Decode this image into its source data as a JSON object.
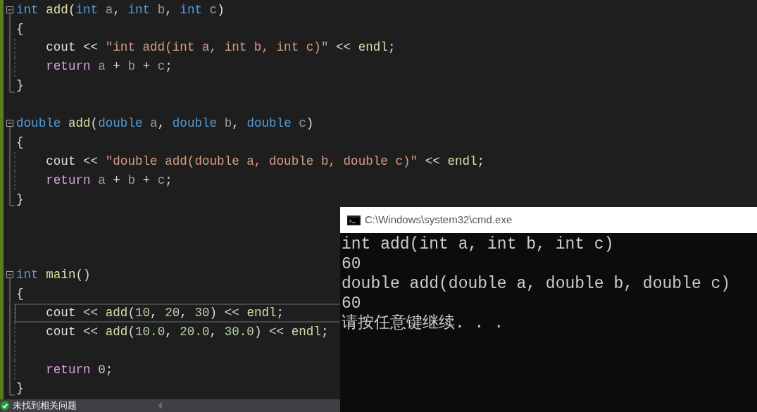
{
  "editor": {
    "lines": [
      {
        "kind": "code",
        "current": false,
        "tokens": [
          {
            "text": "int",
            "kind": "keyword"
          },
          {
            "text": " add",
            "kind": "function"
          },
          {
            "text": "(",
            "kind": "plain"
          },
          {
            "text": "int",
            "kind": "keyword"
          },
          {
            "text": " a",
            "kind": "param"
          },
          {
            "text": ", ",
            "kind": "plain"
          },
          {
            "text": "int",
            "kind": "keyword"
          },
          {
            "text": " b",
            "kind": "param"
          },
          {
            "text": ", ",
            "kind": "plain"
          },
          {
            "text": "int",
            "kind": "keyword"
          },
          {
            "text": " c",
            "kind": "param"
          },
          {
            "text": ")",
            "kind": "plain"
          }
        ],
        "children": [
          {
            "kind": "code",
            "current": false,
            "tokens": [
              {
                "text": "{",
                "kind": "plain"
              }
            ]
          },
          {
            "kind": "code",
            "current": false,
            "tokens": [
              {
                "text": "    cout << ",
                "kind": "plain"
              },
              {
                "text": "\"int add(int a, int b, int c)\"",
                "kind": "string"
              },
              {
                "text": " << ",
                "kind": "plain"
              },
              {
                "text": "endl",
                "kind": "function"
              },
              {
                "text": ";",
                "kind": "plain"
              }
            ]
          },
          {
            "kind": "code",
            "current": false,
            "tokens": [
              {
                "text": "    return",
                "kind": "control"
              },
              {
                "text": " a",
                "kind": "param"
              },
              {
                "text": " + ",
                "kind": "plain"
              },
              {
                "text": "b",
                "kind": "param"
              },
              {
                "text": " + ",
                "kind": "plain"
              },
              {
                "text": "c",
                "kind": "param"
              },
              {
                "text": ";",
                "kind": "plain"
              }
            ]
          },
          {
            "kind": "code",
            "current": false,
            "tokens": [
              {
                "text": "}",
                "kind": "plain"
              }
            ]
          }
        ]
      },
      {
        "kind": "blank"
      },
      {
        "kind": "code",
        "current": false,
        "tokens": [
          {
            "text": "double",
            "kind": "keyword"
          },
          {
            "text": " add",
            "kind": "function"
          },
          {
            "text": "(",
            "kind": "plain"
          },
          {
            "text": "double",
            "kind": "keyword"
          },
          {
            "text": " a",
            "kind": "param"
          },
          {
            "text": ", ",
            "kind": "plain"
          },
          {
            "text": "double",
            "kind": "keyword"
          },
          {
            "text": " b",
            "kind": "param"
          },
          {
            "text": ", ",
            "kind": "plain"
          },
          {
            "text": "double",
            "kind": "keyword"
          },
          {
            "text": " c",
            "kind": "param"
          },
          {
            "text": ")",
            "kind": "plain"
          }
        ],
        "children": [
          {
            "kind": "code",
            "current": false,
            "tokens": [
              {
                "text": "{",
                "kind": "plain"
              }
            ]
          },
          {
            "kind": "code",
            "current": false,
            "tokens": [
              {
                "text": "    cout << ",
                "kind": "plain"
              },
              {
                "text": "\"double add(double a, double b, double c)\"",
                "kind": "string"
              },
              {
                "text": " << ",
                "kind": "plain"
              },
              {
                "text": "endl",
                "kind": "function"
              },
              {
                "text": ";",
                "kind": "plain"
              }
            ]
          },
          {
            "kind": "code",
            "current": false,
            "tokens": [
              {
                "text": "    return",
                "kind": "control"
              },
              {
                "text": " a",
                "kind": "param"
              },
              {
                "text": " + ",
                "kind": "plain"
              },
              {
                "text": "b",
                "kind": "param"
              },
              {
                "text": " + ",
                "kind": "plain"
              },
              {
                "text": "c",
                "kind": "param"
              },
              {
                "text": ";",
                "kind": "plain"
              }
            ]
          },
          {
            "kind": "code",
            "current": false,
            "tokens": [
              {
                "text": "}",
                "kind": "plain"
              }
            ]
          }
        ]
      },
      {
        "kind": "blank"
      },
      {
        "kind": "blank"
      },
      {
        "kind": "blank"
      },
      {
        "kind": "code",
        "current": false,
        "tokens": [
          {
            "text": "int",
            "kind": "keyword"
          },
          {
            "text": " main",
            "kind": "function"
          },
          {
            "text": "()",
            "kind": "plain"
          }
        ],
        "children": [
          {
            "kind": "code",
            "current": false,
            "tokens": [
              {
                "text": "{",
                "kind": "plain"
              }
            ]
          },
          {
            "kind": "code",
            "current": true,
            "tokens": [
              {
                "text": "    cout << ",
                "kind": "plain"
              },
              {
                "text": "add",
                "kind": "function"
              },
              {
                "text": "(",
                "kind": "plain"
              },
              {
                "text": "10",
                "kind": "number"
              },
              {
                "text": ", ",
                "kind": "plain"
              },
              {
                "text": "20",
                "kind": "number"
              },
              {
                "text": ", ",
                "kind": "plain"
              },
              {
                "text": "30",
                "kind": "number"
              },
              {
                "text": ") << ",
                "kind": "plain"
              },
              {
                "text": "endl",
                "kind": "function"
              },
              {
                "text": ";",
                "kind": "plain"
              }
            ]
          },
          {
            "kind": "code",
            "current": false,
            "tokens": [
              {
                "text": "    cout << ",
                "kind": "plain"
              },
              {
                "text": "add",
                "kind": "function"
              },
              {
                "text": "(",
                "kind": "plain"
              },
              {
                "text": "10.0",
                "kind": "number"
              },
              {
                "text": ", ",
                "kind": "plain"
              },
              {
                "text": "20.0",
                "kind": "number"
              },
              {
                "text": ", ",
                "kind": "plain"
              },
              {
                "text": "30.0",
                "kind": "number"
              },
              {
                "text": ") << ",
                "kind": "plain"
              },
              {
                "text": "endl",
                "kind": "function"
              },
              {
                "text": ";",
                "kind": "plain"
              }
            ]
          },
          {
            "kind": "blank"
          },
          {
            "kind": "code",
            "current": false,
            "tokens": [
              {
                "text": "    return",
                "kind": "control"
              },
              {
                "text": " 0",
                "kind": "number"
              },
              {
                "text": ";",
                "kind": "plain"
              }
            ]
          },
          {
            "kind": "code",
            "current": false,
            "tokens": [
              {
                "text": "}",
                "kind": "plain"
              }
            ]
          }
        ]
      }
    ]
  },
  "status_bar": {
    "message": "未找到相关问题",
    "ok": true
  },
  "console": {
    "title": "C:\\Windows\\system32\\cmd.exe",
    "lines": [
      "int add(int a, int b, int c)",
      "60",
      "double add(double a, double b, double c)",
      "60",
      "请按任意键继续. . ."
    ]
  }
}
